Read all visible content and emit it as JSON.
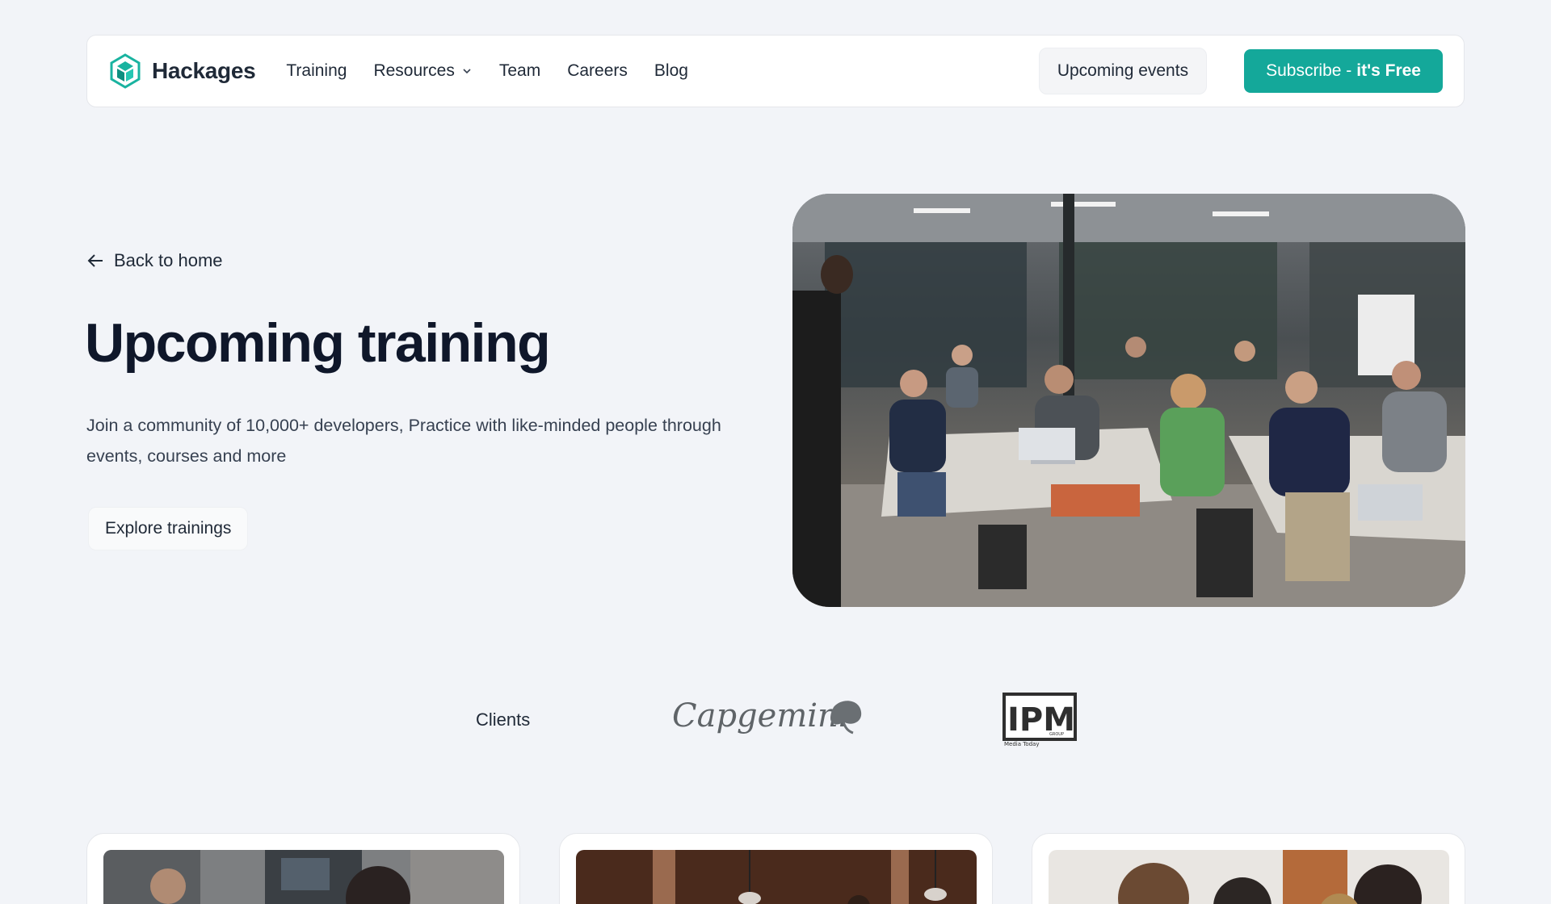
{
  "navbar": {
    "brand": "Hackages",
    "links": [
      {
        "label": "Training"
      },
      {
        "label": "Resources"
      },
      {
        "label": "Team"
      },
      {
        "label": "Careers"
      },
      {
        "label": "Blog"
      }
    ],
    "events_button": "Upcoming events",
    "subscribe_prefix": "Subscribe -",
    "subscribe_strong": "it's Free"
  },
  "hero": {
    "back_label": "Back to home",
    "title": "Upcoming training",
    "description": "Join a community of 10,000+ developers, Practice with like-minded people through events, courses and more",
    "explore_button": "Explore trainings"
  },
  "clients": {
    "label": "Clients",
    "logos": [
      {
        "name": "Capgemini",
        "text": "Capgemini"
      },
      {
        "name": "IPM Group",
        "text": "IPM",
        "sub": "GROUP",
        "tagline": "Media Today"
      }
    ]
  },
  "colors": {
    "accent": "#14a89a",
    "background": "#f2f4f8",
    "heading": "#0f172a"
  }
}
